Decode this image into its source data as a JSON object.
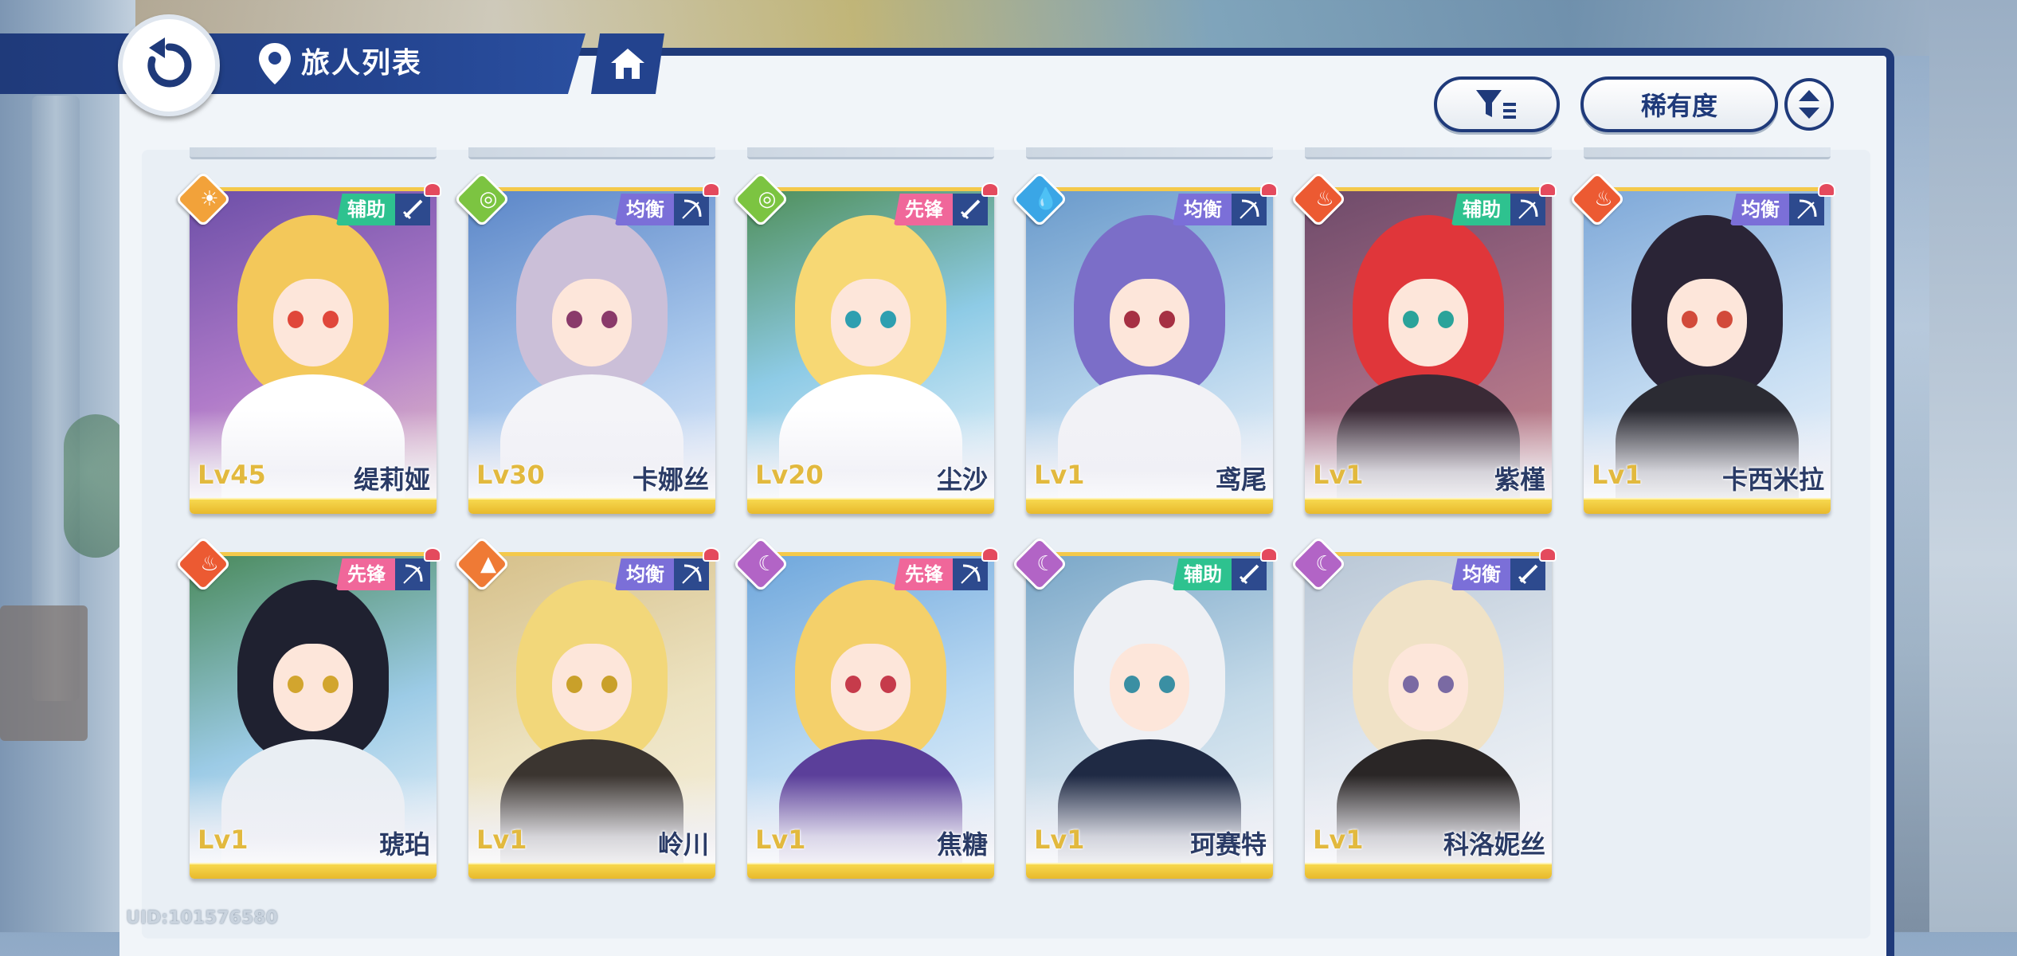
{
  "header": {
    "title": "旅人列表",
    "back_icon": "back-arrow-icon",
    "location_icon": "location-pin-icon",
    "home_icon": "home-icon"
  },
  "toolbar": {
    "filter_icon": "filter-icon",
    "sort_label": "稀有度",
    "order_icon": "sort-order-icon"
  },
  "colors": {
    "header_navy": "#1f3a7a",
    "support": "#2ec28f",
    "balanced": "#7b6fd8",
    "vanguard": "#f0679a",
    "light": "#f2a23a",
    "wind": "#7cc441",
    "water": "#3aa6e6",
    "fire": "#ec5a32",
    "earth": "#ef7a35",
    "moon": "#b264c6"
  },
  "characters": [
    {
      "name": "缇莉娅",
      "level": "Lv45",
      "role": "辅助",
      "element": "light",
      "weapon": "sword"
    },
    {
      "name": "卡娜丝",
      "level": "Lv30",
      "role": "均衡",
      "element": "wind",
      "weapon": "bow"
    },
    {
      "name": "尘沙",
      "level": "Lv20",
      "role": "先锋",
      "element": "wind",
      "weapon": "sword"
    },
    {
      "name": "鸢尾",
      "level": "Lv1",
      "role": "均衡",
      "element": "water",
      "weapon": "bow"
    },
    {
      "name": "紫槿",
      "level": "Lv1",
      "role": "辅助",
      "element": "fire",
      "weapon": "bow"
    },
    {
      "name": "卡西米拉",
      "level": "Lv1",
      "role": "均衡",
      "element": "fire",
      "weapon": "bow"
    },
    {
      "name": "琥珀",
      "level": "Lv1",
      "role": "先锋",
      "element": "fire",
      "weapon": "bow"
    },
    {
      "name": "岭川",
      "level": "Lv1",
      "role": "均衡",
      "element": "earth",
      "weapon": "bow"
    },
    {
      "name": "焦糖",
      "level": "Lv1",
      "role": "先锋",
      "element": "moon",
      "weapon": "bow"
    },
    {
      "name": "珂赛特",
      "level": "Lv1",
      "role": "辅助",
      "element": "moon",
      "weapon": "sword"
    },
    {
      "name": "科洛妮丝",
      "level": "Lv1",
      "role": "均衡",
      "element": "moon",
      "weapon": "sword"
    }
  ],
  "footer": {
    "uid": "UID:101576580"
  }
}
